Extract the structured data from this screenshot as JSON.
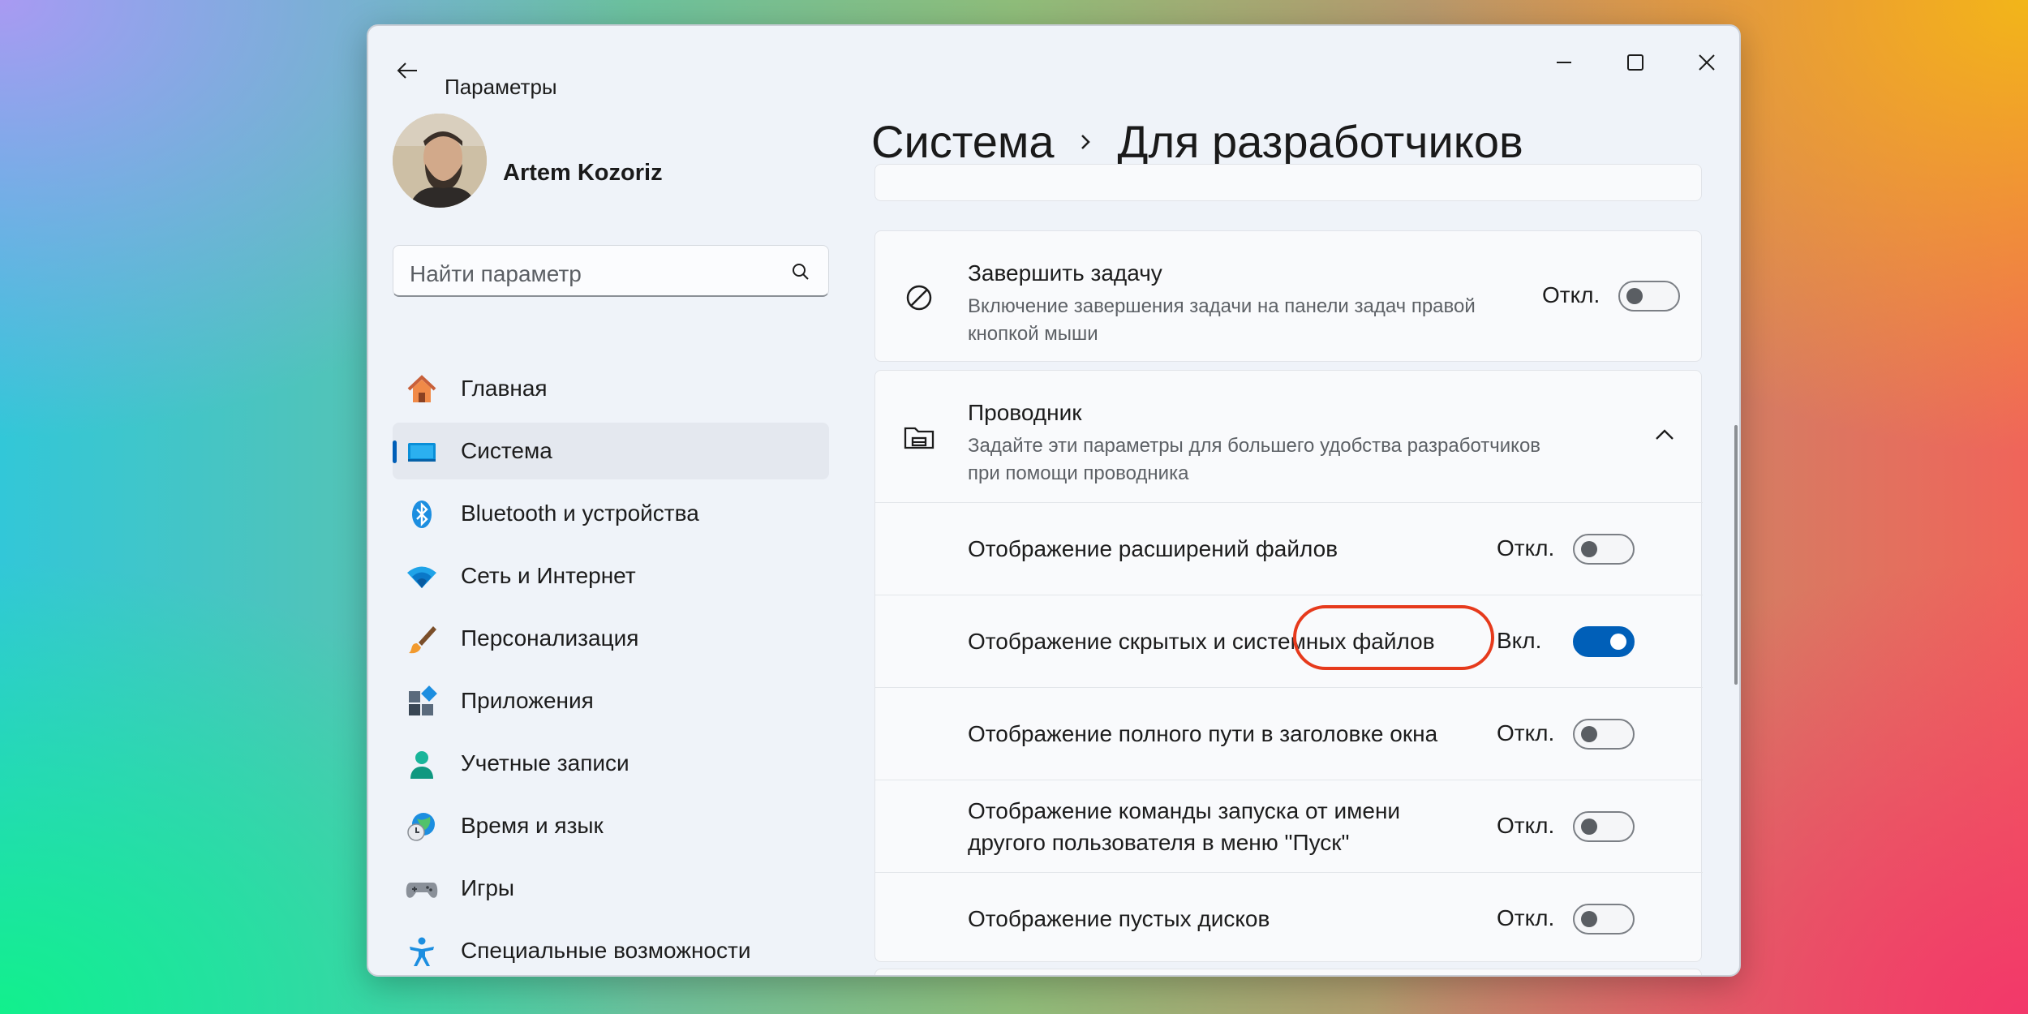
{
  "window": {
    "app_title": "Параметры"
  },
  "user": {
    "name": "Artem Kozoriz"
  },
  "search": {
    "placeholder": "Найти параметр"
  },
  "sidebar": {
    "items": [
      {
        "label": "Главная",
        "icon": "home-icon"
      },
      {
        "label": "Система",
        "icon": "system-icon",
        "active": true
      },
      {
        "label": "Bluetooth и устройства",
        "icon": "bluetooth-icon"
      },
      {
        "label": "Сеть и Интернет",
        "icon": "wifi-icon"
      },
      {
        "label": "Персонализация",
        "icon": "brush-icon"
      },
      {
        "label": "Приложения",
        "icon": "apps-icon"
      },
      {
        "label": "Учетные записи",
        "icon": "account-icon"
      },
      {
        "label": "Время и язык",
        "icon": "time-language-icon"
      },
      {
        "label": "Игры",
        "icon": "gamepad-icon"
      },
      {
        "label": "Специальные возможности",
        "icon": "accessibility-icon"
      }
    ]
  },
  "breadcrumb": {
    "parent": "Система",
    "current": "Для разработчиков"
  },
  "end_task": {
    "title": "Завершить задачу",
    "description": "Включение завершения задачи на панели задач правой кнопкой мыши",
    "state_label": "Откл.",
    "on": false
  },
  "explorer": {
    "title": "Проводник",
    "description": "Задайте эти параметры для большего удобства разработчиков при помощи проводника",
    "expanded": true,
    "settings": [
      {
        "label": "Отображение расширений файлов",
        "state_label": "Откл.",
        "on": false
      },
      {
        "label": "Отображение скрытых и системных файлов",
        "state_label": "Вкл.",
        "on": true
      },
      {
        "label": "Отображение полного пути в заголовке окна",
        "state_label": "Откл.",
        "on": false
      },
      {
        "label": "Отображение команды запуска от имени другого пользователя в меню \"Пуск\"",
        "state_label": "Откл.",
        "on": false
      },
      {
        "label": "Отображение пустых дисков",
        "state_label": "Откл.",
        "on": false
      }
    ]
  },
  "colors": {
    "accent": "#005fb8",
    "highlight_ring": "#e63a1c"
  }
}
